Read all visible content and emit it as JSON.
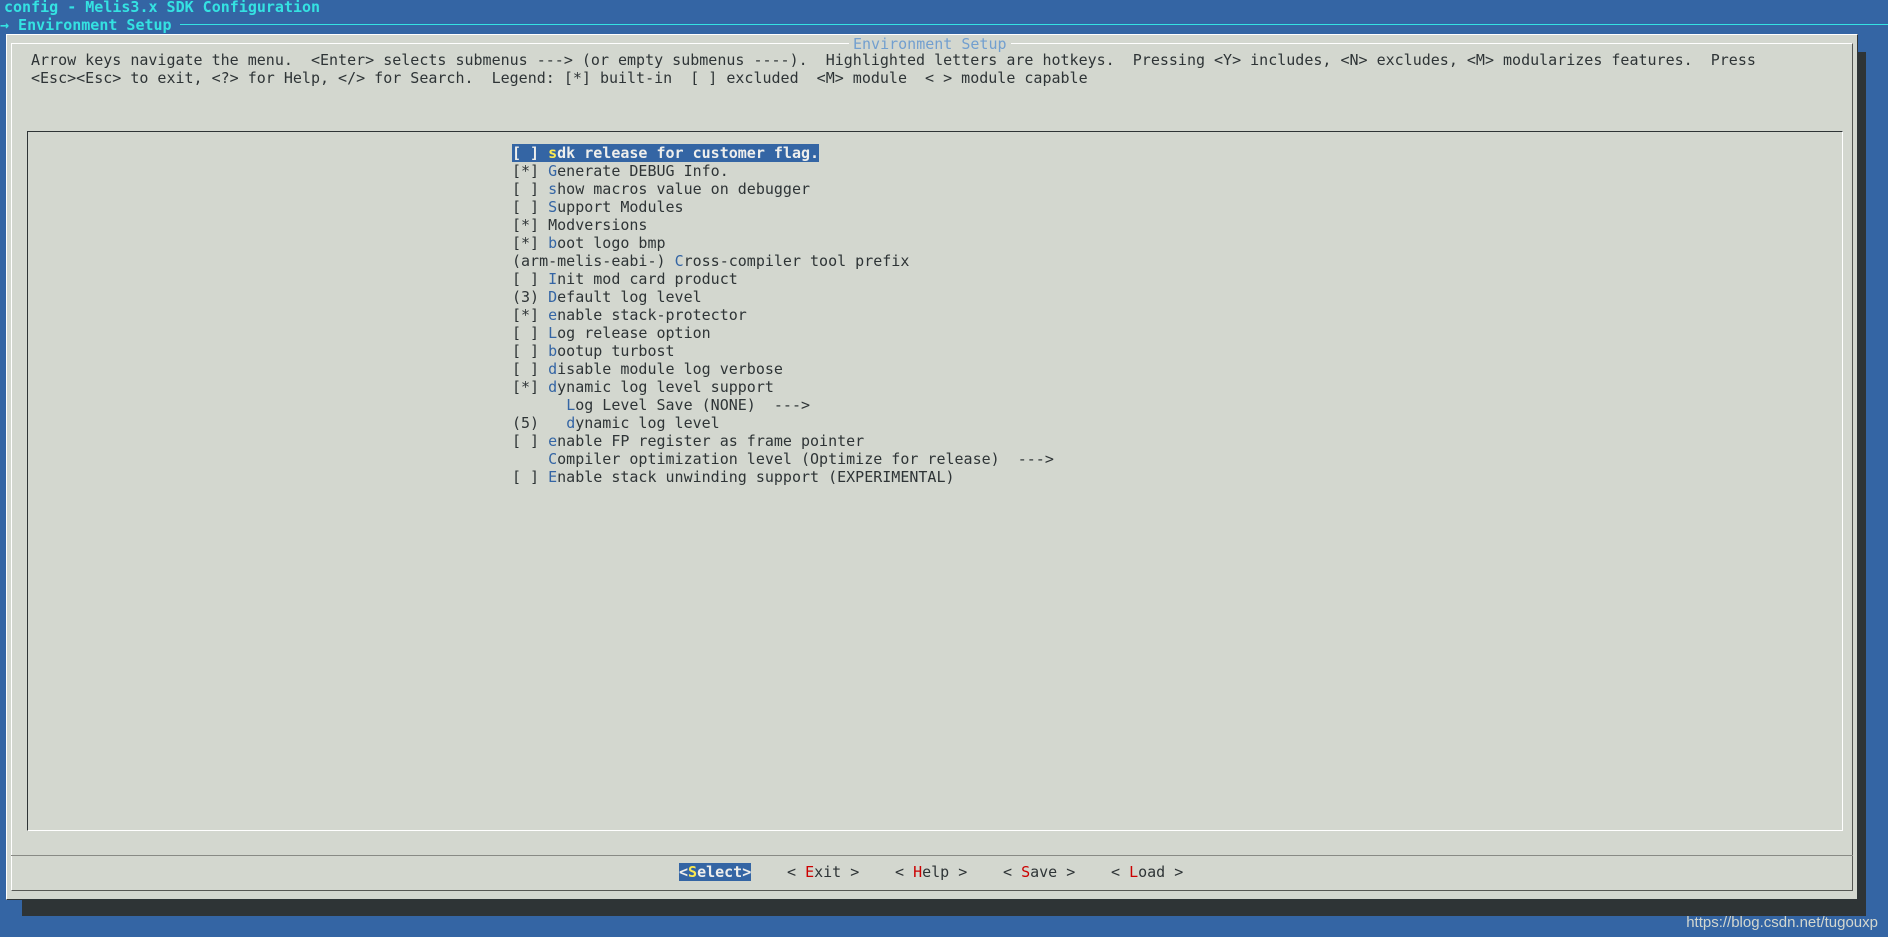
{
  "header": {
    "title": "config - Melis3.x SDK Configuration",
    "subtitle": "→ Environment Setup"
  },
  "dialog": {
    "title": "Environment Setup",
    "help_line_1": "Arrow keys navigate the menu.  <Enter> selects submenus ---> (or empty submenus ----).  Highlighted letters are hotkeys.  Pressing <Y> includes, <N> excludes, <M> modularizes features.  Press",
    "help_line_2": "<Esc><Esc> to exit, <?> for Help, </> for Search.  Legend: [*] built-in  [ ] excluded  <M> module  < > module capable"
  },
  "menu": {
    "items": [
      {
        "prefix": "[ ] ",
        "hotkey": "s",
        "rest": "dk release for customer flag.",
        "selected": true
      },
      {
        "prefix": "[*] ",
        "hotkey": "G",
        "rest": "enerate DEBUG Info."
      },
      {
        "prefix": "[ ] ",
        "hotkey": "s",
        "rest": "how macros value on debugger"
      },
      {
        "prefix": "[ ] ",
        "hotkey": "S",
        "rest": "upport Modules"
      },
      {
        "prefix": "[*] ",
        "hotkey": "M",
        "rest": "odversions",
        "hotkey_index": 1
      },
      {
        "prefix": "[*] ",
        "hotkey": "b",
        "rest": "oot logo bmp"
      },
      {
        "prefix": "(arm-melis-eabi-) ",
        "hotkey": "C",
        "rest": "ross-compiler tool prefix"
      },
      {
        "prefix": "[ ] ",
        "hotkey": "I",
        "rest": "nit mod card product"
      },
      {
        "prefix": "(3) ",
        "hotkey": "D",
        "rest": "efault log level"
      },
      {
        "prefix": "[*] ",
        "hotkey": "e",
        "rest": "nable stack-protector"
      },
      {
        "prefix": "[ ] ",
        "hotkey": "L",
        "rest": "og release option"
      },
      {
        "prefix": "[ ] ",
        "hotkey": "b",
        "rest": "ootup turbost"
      },
      {
        "prefix": "[ ] ",
        "hotkey": "d",
        "rest": "isable module log verbose"
      },
      {
        "prefix": "[*] ",
        "hotkey": "d",
        "rest": "ynamic log level support"
      },
      {
        "prefix": "      ",
        "hotkey": "L",
        "rest": "og Level Save (NONE)  --->"
      },
      {
        "prefix": "(5)   ",
        "hotkey": "d",
        "rest": "ynamic log level"
      },
      {
        "prefix": "[ ] ",
        "hotkey": "e",
        "rest": "nable FP register as frame pointer"
      },
      {
        "prefix": "    ",
        "hotkey": "C",
        "rest": "ompiler optimization level (Optimize for release)  --->"
      },
      {
        "prefix": "[ ] ",
        "hotkey": "E",
        "rest": "nable stack unwinding support (EXPERIMENTAL)"
      }
    ]
  },
  "buttons": [
    {
      "left": "<",
      "hotkey": "S",
      "rest": "elect",
      "right": ">",
      "active": true
    },
    {
      "left": "< ",
      "hotkey": "E",
      "rest": "xit",
      "right": " >"
    },
    {
      "left": "< ",
      "hotkey": "H",
      "rest": "elp",
      "right": " >"
    },
    {
      "left": "< ",
      "hotkey": "S",
      "rest": "ave",
      "right": " >"
    },
    {
      "left": "< ",
      "hotkey": "L",
      "rest": "oad",
      "right": " >"
    }
  ],
  "watermark": "https://blog.csdn.net/tugouxp"
}
